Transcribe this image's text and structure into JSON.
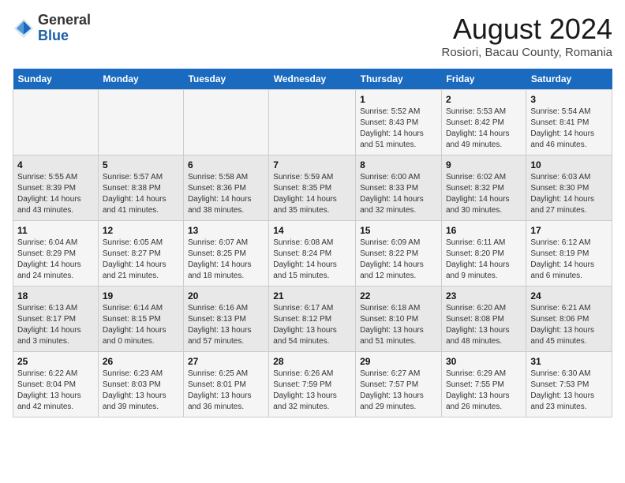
{
  "header": {
    "logo_general": "General",
    "logo_blue": "Blue",
    "title": "August 2024",
    "subtitle": "Rosiori, Bacau County, Romania"
  },
  "weekdays": [
    "Sunday",
    "Monday",
    "Tuesday",
    "Wednesday",
    "Thursday",
    "Friday",
    "Saturday"
  ],
  "weeks": [
    [
      {
        "day": "",
        "info": ""
      },
      {
        "day": "",
        "info": ""
      },
      {
        "day": "",
        "info": ""
      },
      {
        "day": "",
        "info": ""
      },
      {
        "day": "1",
        "info": "Sunrise: 5:52 AM\nSunset: 8:43 PM\nDaylight: 14 hours\nand 51 minutes."
      },
      {
        "day": "2",
        "info": "Sunrise: 5:53 AM\nSunset: 8:42 PM\nDaylight: 14 hours\nand 49 minutes."
      },
      {
        "day": "3",
        "info": "Sunrise: 5:54 AM\nSunset: 8:41 PM\nDaylight: 14 hours\nand 46 minutes."
      }
    ],
    [
      {
        "day": "4",
        "info": "Sunrise: 5:55 AM\nSunset: 8:39 PM\nDaylight: 14 hours\nand 43 minutes."
      },
      {
        "day": "5",
        "info": "Sunrise: 5:57 AM\nSunset: 8:38 PM\nDaylight: 14 hours\nand 41 minutes."
      },
      {
        "day": "6",
        "info": "Sunrise: 5:58 AM\nSunset: 8:36 PM\nDaylight: 14 hours\nand 38 minutes."
      },
      {
        "day": "7",
        "info": "Sunrise: 5:59 AM\nSunset: 8:35 PM\nDaylight: 14 hours\nand 35 minutes."
      },
      {
        "day": "8",
        "info": "Sunrise: 6:00 AM\nSunset: 8:33 PM\nDaylight: 14 hours\nand 32 minutes."
      },
      {
        "day": "9",
        "info": "Sunrise: 6:02 AM\nSunset: 8:32 PM\nDaylight: 14 hours\nand 30 minutes."
      },
      {
        "day": "10",
        "info": "Sunrise: 6:03 AM\nSunset: 8:30 PM\nDaylight: 14 hours\nand 27 minutes."
      }
    ],
    [
      {
        "day": "11",
        "info": "Sunrise: 6:04 AM\nSunset: 8:29 PM\nDaylight: 14 hours\nand 24 minutes."
      },
      {
        "day": "12",
        "info": "Sunrise: 6:05 AM\nSunset: 8:27 PM\nDaylight: 14 hours\nand 21 minutes."
      },
      {
        "day": "13",
        "info": "Sunrise: 6:07 AM\nSunset: 8:25 PM\nDaylight: 14 hours\nand 18 minutes."
      },
      {
        "day": "14",
        "info": "Sunrise: 6:08 AM\nSunset: 8:24 PM\nDaylight: 14 hours\nand 15 minutes."
      },
      {
        "day": "15",
        "info": "Sunrise: 6:09 AM\nSunset: 8:22 PM\nDaylight: 14 hours\nand 12 minutes."
      },
      {
        "day": "16",
        "info": "Sunrise: 6:11 AM\nSunset: 8:20 PM\nDaylight: 14 hours\nand 9 minutes."
      },
      {
        "day": "17",
        "info": "Sunrise: 6:12 AM\nSunset: 8:19 PM\nDaylight: 14 hours\nand 6 minutes."
      }
    ],
    [
      {
        "day": "18",
        "info": "Sunrise: 6:13 AM\nSunset: 8:17 PM\nDaylight: 14 hours\nand 3 minutes."
      },
      {
        "day": "19",
        "info": "Sunrise: 6:14 AM\nSunset: 8:15 PM\nDaylight: 14 hours\nand 0 minutes."
      },
      {
        "day": "20",
        "info": "Sunrise: 6:16 AM\nSunset: 8:13 PM\nDaylight: 13 hours\nand 57 minutes."
      },
      {
        "day": "21",
        "info": "Sunrise: 6:17 AM\nSunset: 8:12 PM\nDaylight: 13 hours\nand 54 minutes."
      },
      {
        "day": "22",
        "info": "Sunrise: 6:18 AM\nSunset: 8:10 PM\nDaylight: 13 hours\nand 51 minutes."
      },
      {
        "day": "23",
        "info": "Sunrise: 6:20 AM\nSunset: 8:08 PM\nDaylight: 13 hours\nand 48 minutes."
      },
      {
        "day": "24",
        "info": "Sunrise: 6:21 AM\nSunset: 8:06 PM\nDaylight: 13 hours\nand 45 minutes."
      }
    ],
    [
      {
        "day": "25",
        "info": "Sunrise: 6:22 AM\nSunset: 8:04 PM\nDaylight: 13 hours\nand 42 minutes."
      },
      {
        "day": "26",
        "info": "Sunrise: 6:23 AM\nSunset: 8:03 PM\nDaylight: 13 hours\nand 39 minutes."
      },
      {
        "day": "27",
        "info": "Sunrise: 6:25 AM\nSunset: 8:01 PM\nDaylight: 13 hours\nand 36 minutes."
      },
      {
        "day": "28",
        "info": "Sunrise: 6:26 AM\nSunset: 7:59 PM\nDaylight: 13 hours\nand 32 minutes."
      },
      {
        "day": "29",
        "info": "Sunrise: 6:27 AM\nSunset: 7:57 PM\nDaylight: 13 hours\nand 29 minutes."
      },
      {
        "day": "30",
        "info": "Sunrise: 6:29 AM\nSunset: 7:55 PM\nDaylight: 13 hours\nand 26 minutes."
      },
      {
        "day": "31",
        "info": "Sunrise: 6:30 AM\nSunset: 7:53 PM\nDaylight: 13 hours\nand 23 minutes."
      }
    ]
  ]
}
